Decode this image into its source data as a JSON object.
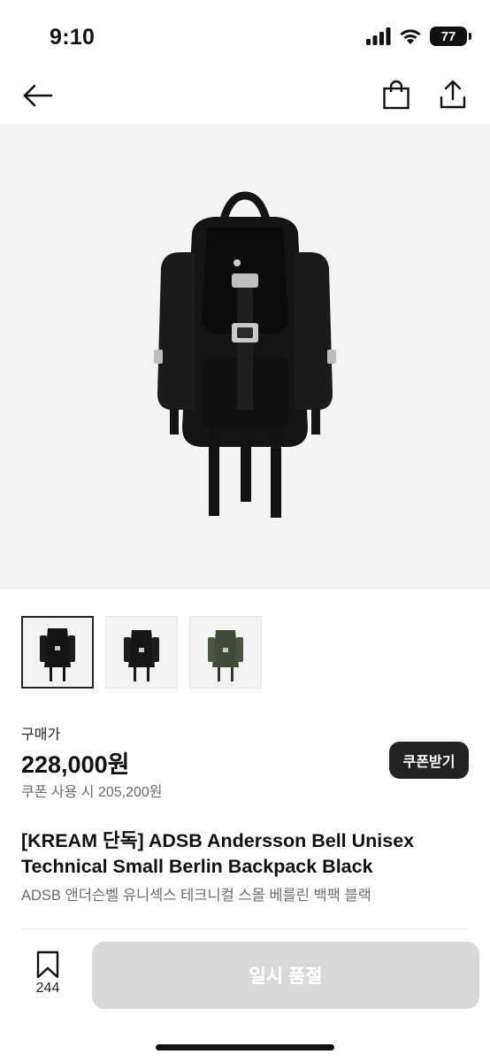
{
  "status_bar": {
    "time": "9:10",
    "battery": "77"
  },
  "nav": {
    "back_icon": "arrow-left-icon",
    "bag_icon": "shopping-bag-icon",
    "share_icon": "share-icon"
  },
  "gallery": {
    "thumbnails": [
      {
        "name": "black backpack",
        "selected": true
      },
      {
        "name": "black backpack",
        "selected": false
      },
      {
        "name": "green backpack",
        "selected": false
      }
    ]
  },
  "price": {
    "label": "구매가",
    "amount": "228,000원",
    "coupon_text": "쿠폰 사용 시 205,200원",
    "coupon_button": "쿠폰받기"
  },
  "product": {
    "title_en": "[KREAM 단독] ADSB Andersson Bell Unisex Technical Small Berlin Backpack Black",
    "title_ko": "ADSB 앤더슨벨 유니섹스 테크니컬 스몰 베를린 백팩 블랙"
  },
  "bottom_bar": {
    "wish_count": "244",
    "soldout_label": "일시 품절"
  },
  "colors": {
    "accent_dark": "#222222",
    "disabled": "#d9d9d9",
    "hero_bg": "#f3f3f3"
  }
}
